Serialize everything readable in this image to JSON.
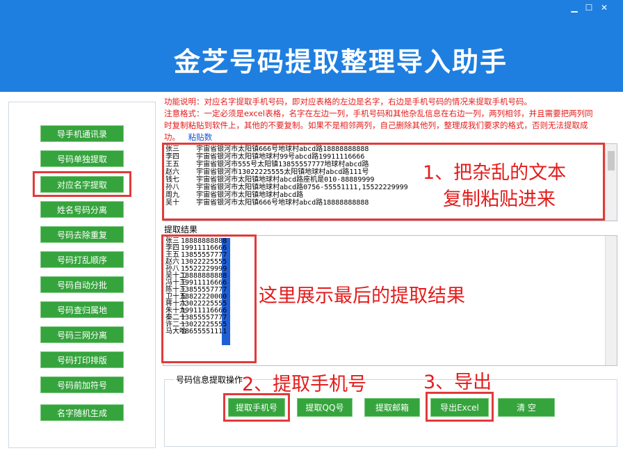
{
  "app_title": "金芝号码提取整理导入助手",
  "window_controls": [
    "▁",
    "☐",
    "✕"
  ],
  "sidebar": [
    "导手机通讯录",
    "号码单独提取",
    "对应名字提取",
    "姓名号码分离",
    "号码去除重复",
    "号码打乱顺序",
    "号码自动分批",
    "号码查归属地",
    "号码三网分离",
    "号码打印排版",
    "号码前加符号",
    "名字随机生成"
  ],
  "description": {
    "line1": "功能说明：对应名字提取手机号码，即对应表格的左边是名字，右边是手机号码的情况来提取手机号码。",
    "line2": "注意格式：一定必须是excel表格，名字在左边一列，手机号码和其他杂乱信息在右边一列，两列相邻，并且需要把两列同",
    "line3": "时复制粘贴到软件上，其他的不要复制。如果不是相邻两列，自己删除其他列，整理成我们要求的格式，否则无法提取成",
    "line4": "功。",
    "paste_link": "粘贴数据"
  },
  "input_rows": [
    "张三    宇宙省银河市太阳镇666号地球村abcd路18888888888",
    "李四    宇宙省银河市太阳镇地球村99号abcd路19911116666",
    "王五    宇宙省银河市555号太阳镇13855557777地球村abcd路",
    "赵六    宇宙省银河市13022225555太阳镇地球村abcd路111号",
    "钱七    宇宙省银河市太阳镇地球村abcd路座机是010-88889999",
    "孙八    宇宙省银河市太阳镇地球村abcd路0756-55551111,15522229999",
    "周九    宇宙省银河市太阳镇地球村abcd路",
    "吴十    宇宙省银河市太阳镇666号地球村abcd路18888888888"
  ],
  "annotation1_line1": "1、把杂乱的文本",
  "annotation1_line2": "复制粘贴进来",
  "result_label": "提取结果",
  "results": [
    {
      "name": "张三",
      "phone": "18888888888"
    },
    {
      "name": "李四",
      "phone": "19911116666"
    },
    {
      "name": "王五",
      "phone": "13855557777"
    },
    {
      "name": "赵六",
      "phone": "13022225555"
    },
    {
      "name": "孙八",
      "phone": "15522229999"
    },
    {
      "name": "吴十二",
      "phone": "18888888888"
    },
    {
      "name": "冯十三",
      "phone": "19911116666"
    },
    {
      "name": "陈十三",
      "phone": "13855557777"
    },
    {
      "name": "卫十五",
      "phone": "18822220000"
    },
    {
      "name": "蒋十六",
      "phone": "13022225555"
    },
    {
      "name": "朱十九",
      "phone": "19911116666"
    },
    {
      "name": "秦二十",
      "phone": "13855557777"
    },
    {
      "name": "许二一",
      "phone": "13022225555"
    },
    {
      "name": "马大哈",
      "phone": "18655551111"
    }
  ],
  "annotation_result": "这里展示最后的提取结果",
  "group_label": "号码信息提取操作",
  "annotation2": "2、提取手机号",
  "annotation3": "3、导出",
  "action_buttons": [
    "提取手机号",
    "提取QQ号",
    "提取邮箱",
    "导出Excel",
    "清  空"
  ],
  "colors": {
    "title_bar": "#1e7fe0",
    "button_green": "#36a43d",
    "annotation_red": "#e31c1c",
    "highlight_blue": "#1f5fd6"
  }
}
